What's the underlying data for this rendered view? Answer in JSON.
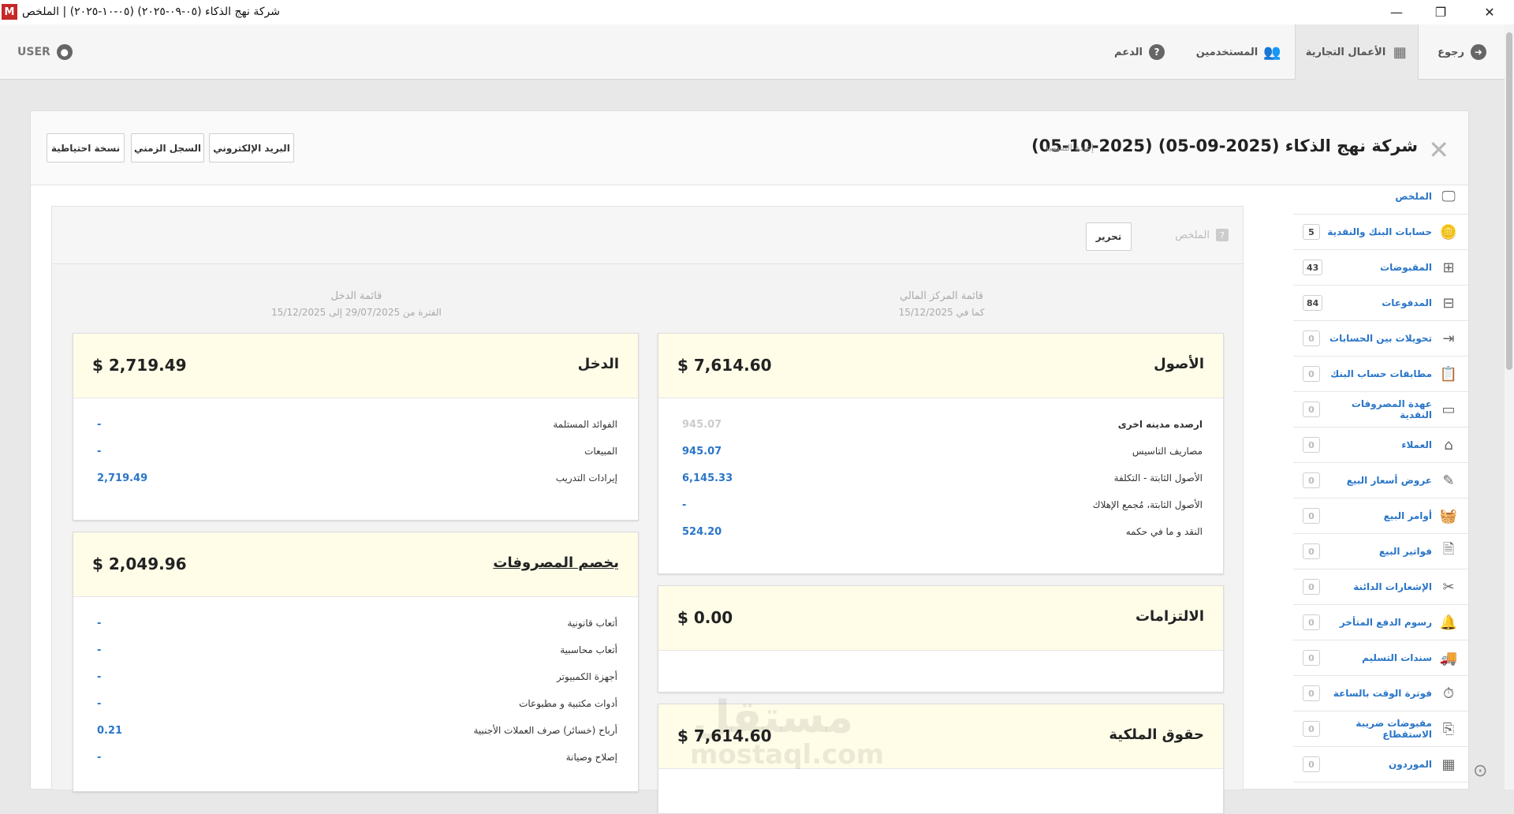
{
  "window": {
    "logo": "M",
    "title": "شركة نهج الذكاء (٠٥-٠٩-٢٠٢٥) (٠٥-١٠-٢٠٢٥) | الملخص",
    "minimize": "—",
    "restore": "❐",
    "close": "✕"
  },
  "nav": {
    "back": "رجوع",
    "business": "الأعمال التجارية",
    "users": "المستخدمين",
    "support": "الدعم",
    "user": "USER"
  },
  "header": {
    "company": "شركة نهج الذكاء (2025-09-05) (2025-10-05)",
    "rename": "إعادة التسمية",
    "buttons": {
      "email": "البريد الإلكتروني",
      "timeline": "السجل الزمني",
      "backup": "نسخة احتياطية"
    }
  },
  "sidebar": {
    "items": [
      {
        "label": "الملخص",
        "count": "",
        "icon": "presentation-icon"
      },
      {
        "label": "حسابات البنك والنقدية",
        "count": "5",
        "icon": "coins-icon"
      },
      {
        "label": "المقبوضات",
        "count": "43",
        "icon": "plus-square-icon"
      },
      {
        "label": "المدفوعات",
        "count": "84",
        "icon": "minus-square-icon"
      },
      {
        "label": "تحويلات بين الحسابات",
        "count": "0",
        "icon": "transfer-arrow-icon"
      },
      {
        "label": "مطابقات حساب البنك",
        "count": "0",
        "icon": "clipboard-check-icon"
      },
      {
        "label": "عهدة المصروفات النقدية",
        "count": "0",
        "icon": "wallet-icon"
      },
      {
        "label": "العملاء",
        "count": "0",
        "icon": "customers-icon"
      },
      {
        "label": "عروض أسعار البيع",
        "count": "0",
        "icon": "quote-icon"
      },
      {
        "label": "أوامر البيع",
        "count": "0",
        "icon": "basket-icon"
      },
      {
        "label": "فواتير البيع",
        "count": "0",
        "icon": "invoice-icon"
      },
      {
        "label": "الإشعارات الدائنة",
        "count": "0",
        "icon": "scissors-icon"
      },
      {
        "label": "رسوم الدفع المتأخر",
        "count": "0",
        "icon": "bell-icon"
      },
      {
        "label": "سندات التسليم",
        "count": "0",
        "icon": "truck-icon"
      },
      {
        "label": "فوترة الوقت بالساعة",
        "count": "0",
        "icon": "stopwatch-icon"
      },
      {
        "label": "مقبوضات ضريبة الاستقطاع",
        "count": "0",
        "icon": "tax-receipt-icon"
      },
      {
        "label": "الموردون",
        "count": "0",
        "icon": "building-icon"
      }
    ]
  },
  "summary": {
    "label": "الملخص",
    "help": "?",
    "edit": "تحرير",
    "balance_sheet": {
      "title": "قائمة المركز المالي",
      "sub": "كما في 15/12/2025"
    },
    "income_statement": {
      "title": "قائمة الدخل",
      "sub": "الفترة من 29/07/2025 إلى 15/12/2025"
    }
  },
  "assets": {
    "title": "الأصول",
    "total": "$ 7,614.60",
    "rows": [
      {
        "label": "ارصده مدينه اخرى",
        "value": "945.07",
        "muted": true,
        "bold": true
      },
      {
        "label": "مصاريف التاسيس",
        "value": "945.07"
      },
      {
        "label": "الأصول الثابتة - التكلفة",
        "value": "6,145.33"
      },
      {
        "label": "الأصول الثابتة، مُجمع الإهلاك",
        "value": "-"
      },
      {
        "label": "النقد و ما في حكمه",
        "value": "524.20"
      }
    ]
  },
  "liabilities": {
    "title": "الالتزامات",
    "total": "$ 0.00"
  },
  "equity": {
    "title": "حقوق الملكية",
    "total": "$ 7,614.60"
  },
  "income": {
    "title": "الدخل",
    "total": "$ 2,719.49",
    "rows": [
      {
        "label": "الفوائد المستلمة",
        "value": "-"
      },
      {
        "label": "المبيعات",
        "value": "-"
      },
      {
        "label": "إيرادات التدريب",
        "value": "2,719.49"
      }
    ]
  },
  "expenses": {
    "title": "يخصم المصروفات",
    "total": "$ 2,049.96",
    "rows": [
      {
        "label": "أتعاب قانونية",
        "value": "-"
      },
      {
        "label": "أتعاب محاسبية",
        "value": "-"
      },
      {
        "label": "أجهزة الكمبيوتر",
        "value": "-"
      },
      {
        "label": "أدوات مكتبية و مطبوعات",
        "value": "-"
      },
      {
        "label": "أرباح (خسائر) صرف العملات الأجنبية",
        "value": "0.21"
      },
      {
        "label": "إصلاح وصيانة",
        "value": "-"
      }
    ]
  },
  "watermark": {
    "line1": "مستقل",
    "line2": "mostaql.com"
  },
  "colors": {
    "accent": "#2a76c8",
    "card_head": "#fffde8",
    "logo": "#c62828"
  }
}
